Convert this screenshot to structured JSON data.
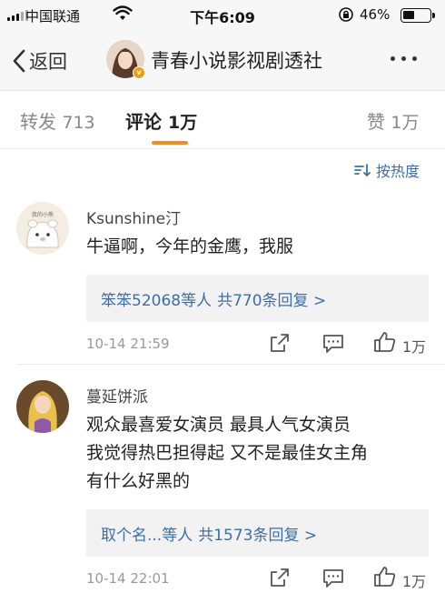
{
  "status_bar": {
    "carrier": "中国联通",
    "time": "下午6:09",
    "battery_pct": "46%",
    "battery_level": 0.46
  },
  "nav": {
    "back_label": "返回",
    "title": "青春小说影视剧透社",
    "badge": "v"
  },
  "tabs": [
    {
      "label": "转发",
      "count": "713"
    },
    {
      "label": "评论",
      "count": "1万"
    },
    {
      "label": "赞",
      "count": "1万"
    }
  ],
  "sort_label": "按热度",
  "comments": [
    {
      "user": "Ksunshine汀",
      "avatar_text": "我的小熊",
      "text": "牛逼啊，今年的金鹰，我服",
      "reply_users": "笨笨52068等人",
      "reply_count": "共770条回复 >",
      "time": "10-14 21:59",
      "likes": "1万"
    },
    {
      "user": "蔓延饼派",
      "text": "观众最喜爱女演员 最具人气女演员\n我觉得热巴担得起 又不是最佳女主角\n有什么好黑的",
      "reply_users": "取个名...等人",
      "reply_count": "共1573条回复 >",
      "time": "10-14 22:01",
      "likes": "1万"
    }
  ],
  "colors": {
    "link": "#3f6ea7",
    "accent": "#f78a1e",
    "badge": "#f29b0f"
  }
}
